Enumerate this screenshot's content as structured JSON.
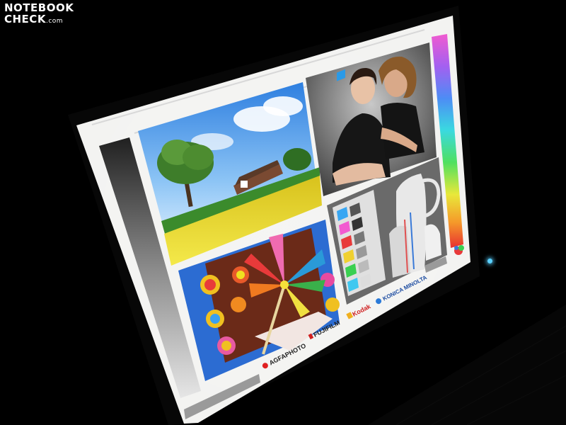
{
  "watermark": {
    "line1": "NOTEBOOK",
    "line2": "CHECK",
    "line3": ".com"
  },
  "brands": {
    "agfa": "AGFAPHOTO",
    "fujifilm": "FUJIFILM",
    "kodak": "Kodak",
    "konica": "KONICA MINOLTA"
  },
  "colors": {
    "screen_white": "#f4f4f2",
    "bezel": "#0a0a0a",
    "sky": "#3f8ee6",
    "field": "#e9d42a",
    "portrait_bg": "#7d7d7d",
    "pinwheel_bg": "#2f6fd1",
    "led": "#5ad0ff"
  },
  "icons": [
    "power-led-icon",
    "color-logo-icon"
  ]
}
